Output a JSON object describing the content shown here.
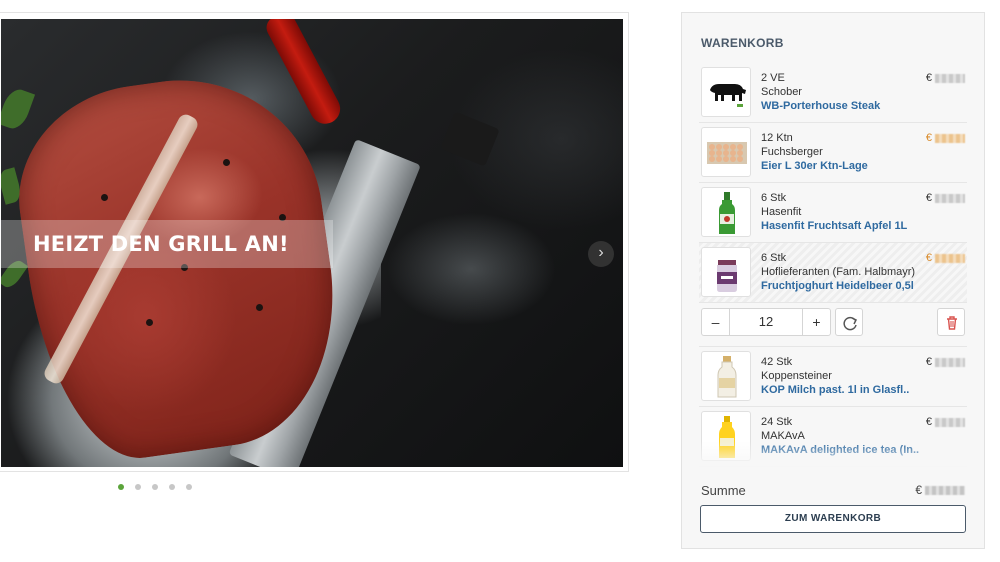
{
  "slider": {
    "headline": "HEIZT DEN GRILL AN!",
    "next_icon": "chevron-right-icon",
    "dots": [
      true,
      false,
      false,
      false,
      false
    ]
  },
  "cart": {
    "title": "WARENKORB",
    "items": [
      {
        "qty": "2 VE",
        "supplier": "Schober",
        "name": "WB-Porterhouse Steak",
        "price_prefix": "€",
        "price_color": "normal",
        "thumb": "cow-icon"
      },
      {
        "qty": "12 Ktn",
        "supplier": "Fuchsberger",
        "name": "Eier L 30er Ktn-Lage",
        "price_prefix": "€",
        "price_color": "orange",
        "thumb": "eggs-tray"
      },
      {
        "qty": "6 Stk",
        "supplier": "Hasenfit",
        "name": "Hasenfit Fruchtsaft Apfel 1L",
        "price_prefix": "€",
        "price_color": "normal",
        "thumb": "green-bottle"
      },
      {
        "qty": "6 Stk",
        "supplier": "Hoflieferanten (Fam. Halbmayr)",
        "name": "Fruchtjoghurt Heidelbeer 0,5l",
        "price_prefix": "€",
        "price_color": "orange",
        "thumb": "yogurt-jar"
      },
      {
        "qty": "42 Stk",
        "supplier": "Koppensteiner",
        "name": "KOP Milch past. 1l in Glasfl..",
        "price_prefix": "€",
        "price_color": "normal",
        "thumb": "milk-bottle"
      },
      {
        "qty": "24 Stk",
        "supplier": "MAKAvA",
        "name": "MAKAvA delighted ice tea (In..",
        "price_prefix": "€",
        "price_color": "normal",
        "thumb": "tea-bottle"
      }
    ],
    "stepper": {
      "minus": "–",
      "value": "12",
      "plus": "+"
    },
    "sum_label": "Summe",
    "sum_prefix": "€",
    "checkout_label": "ZUM WARENKORB",
    "colors": {
      "link": "#2f6aa0",
      "accent_orange": "#d88a2a",
      "active_dot": "#5ba43b"
    }
  }
}
